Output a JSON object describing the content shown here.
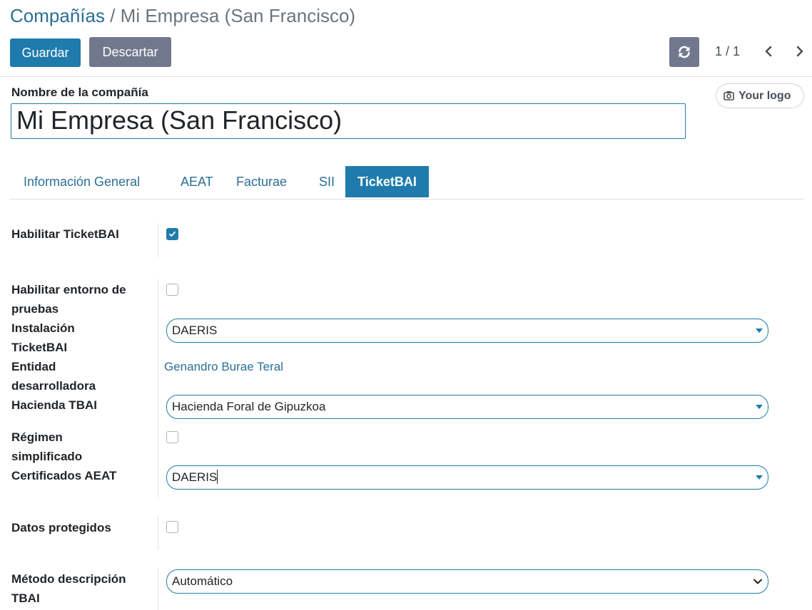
{
  "breadcrumb": {
    "parent": "Compañías",
    "separator": "/",
    "current": "Mi Empresa (San Francisco)"
  },
  "toolbar": {
    "save_label": "Guardar",
    "discard_label": "Descartar",
    "refresh_icon": "refresh-icon",
    "pager": "1 / 1"
  },
  "company": {
    "name_label": "Nombre de la compañía",
    "name_value": "Mi Empresa (San Francisco)",
    "logo_label": "Your logo"
  },
  "tabs": [
    {
      "label": "Información General",
      "active": false
    },
    {
      "label": "AEAT",
      "active": false
    },
    {
      "label": "Facturae",
      "active": false
    },
    {
      "label": "SII",
      "active": false
    },
    {
      "label": "TicketBAI",
      "active": true
    }
  ],
  "form": {
    "enable_tbai": {
      "label": "Habilitar TicketBAI",
      "checked": true
    },
    "test_env": {
      "label": "Habilitar entorno de pruebas",
      "checked": false
    },
    "installation": {
      "label": "Instalación TicketBAI",
      "value": "DAERIS"
    },
    "developer": {
      "label": "Entidad desarrolladora",
      "value": "Genandro Burae Teral"
    },
    "tax_agency": {
      "label": "Hacienda TBAI",
      "value": "Hacienda Foral de Gipuzkoa"
    },
    "simplified": {
      "label": "Régimen simplificado",
      "checked": false
    },
    "certificates": {
      "label": "Certificados AEAT",
      "value": "DAERIS"
    },
    "protected": {
      "label": "Datos protegidos",
      "checked": false
    },
    "description_method": {
      "label": "Método descripción TBAI",
      "value": "Automático"
    }
  },
  "colors": {
    "primary": "#1f7bac",
    "secondary": "#71788e",
    "link": "#2b6f97"
  }
}
